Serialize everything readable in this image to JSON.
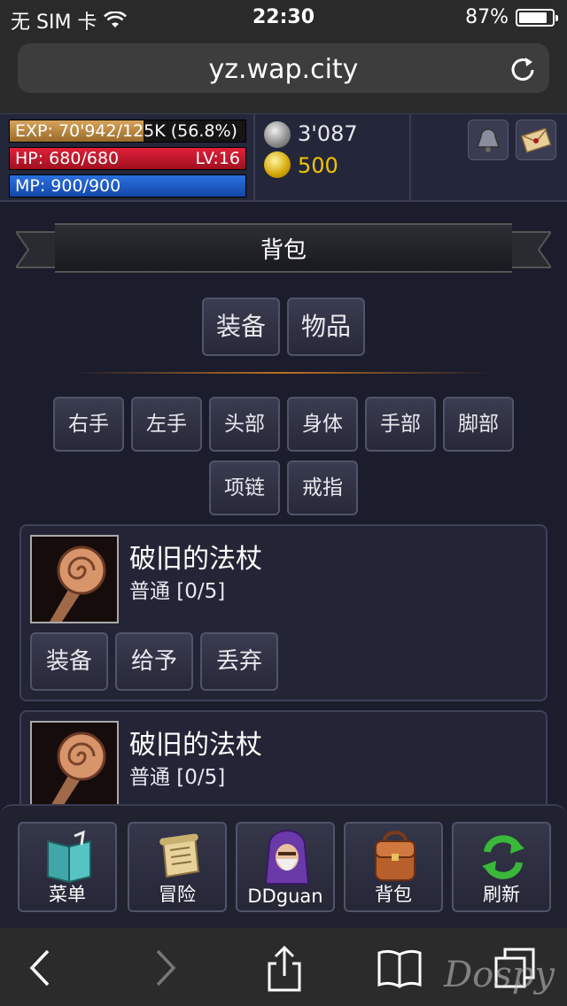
{
  "status_bar": {
    "carrier": "无 SIM 卡",
    "time": "22:30",
    "battery": "87%",
    "battery_level": 0.87
  },
  "browser": {
    "url": "yz.wap.city"
  },
  "hud": {
    "exp_text": "EXP: 70'942/125K (56.8%)",
    "exp_fraction": 0.568,
    "hp_text": "HP: 680/680",
    "level": "LV:16",
    "mp_text": "MP: 900/900",
    "silver": "3'087",
    "gold": "500"
  },
  "page_title": "背包",
  "tabs": [
    "装备",
    "物品"
  ],
  "slots": [
    "右手",
    "左手",
    "头部",
    "身体",
    "手部",
    "脚部",
    "项链",
    "戒指"
  ],
  "items": [
    {
      "name": "破旧的法杖",
      "grade": "普通 [0/5]",
      "actions": [
        "装备",
        "给予",
        "丢弃"
      ]
    },
    {
      "name": "破旧的法杖",
      "grade": "普通 [0/5]"
    }
  ],
  "nav": [
    "菜单",
    "冒险",
    "DDguan",
    "背包",
    "刷新"
  ],
  "watermark": "Dospy",
  "colors": {
    "accent_gold": "#f3c400",
    "hp_red": "#e0203a",
    "mp_blue": "#2a70e0",
    "exp_bronze": "#d7a35a"
  }
}
